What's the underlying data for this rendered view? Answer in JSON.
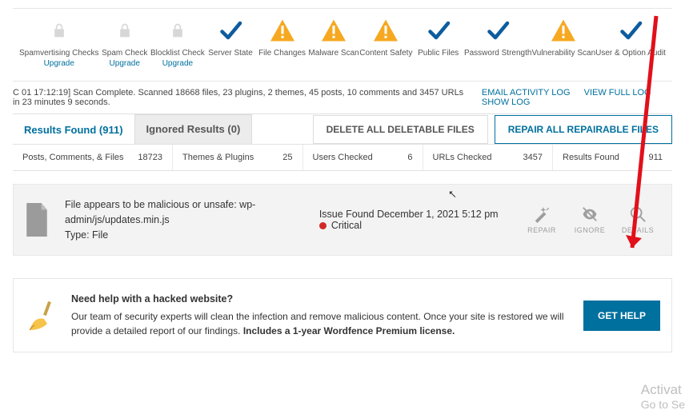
{
  "steps": [
    {
      "label": "Spamvertising Checks",
      "icon": "lock",
      "upgrade": "Upgrade"
    },
    {
      "label": "Spam Check",
      "icon": "lock",
      "upgrade": "Upgrade"
    },
    {
      "label": "Blocklist Check",
      "icon": "lock",
      "upgrade": "Upgrade"
    },
    {
      "label": "Server State",
      "icon": "check"
    },
    {
      "label": "File Changes",
      "icon": "warn"
    },
    {
      "label": "Malware Scan",
      "icon": "warn"
    },
    {
      "label": "Content Safety",
      "icon": "warn"
    },
    {
      "label": "Public Files",
      "icon": "check"
    },
    {
      "label": "Password Strength",
      "icon": "check"
    },
    {
      "label": "Vulnerability Scan",
      "icon": "warn"
    },
    {
      "label": "User & Option Audit",
      "icon": "check"
    }
  ],
  "log_line": "C 01 17:12:19] Scan Complete. Scanned 18668 files, 23 plugins, 2 themes, 45 posts, 10 comments and 3457 URLs in 23 minutes 9 seconds.",
  "log_links": {
    "email": "EMAIL ACTIVITY LOG",
    "view": "VIEW FULL LOG",
    "show": "SHOW LOG"
  },
  "tabs": {
    "found": "Results Found (911)",
    "ignored": "Ignored Results (0)"
  },
  "actions": {
    "delete": "DELETE ALL DELETABLE FILES",
    "repair": "REPAIR ALL REPAIRABLE FILES"
  },
  "stats": [
    {
      "label": "Posts, Comments, & Files",
      "value": "18723"
    },
    {
      "label": "Themes & Plugins",
      "value": "25"
    },
    {
      "label": "Users Checked",
      "value": "6"
    },
    {
      "label": "URLs Checked",
      "value": "3457"
    },
    {
      "label": "Results Found",
      "value": "911"
    }
  ],
  "issue": {
    "file_line": "File appears to be malicious or unsafe: wp-admin/js/updates.min.js",
    "type_line": "Type: File",
    "found_line": "Issue Found December 1, 2021 5:12 pm",
    "sev": "Critical",
    "btn_repair": "REPAIR",
    "btn_ignore": "IGNORE",
    "btn_details": "DETAILS"
  },
  "help": {
    "title": "Need help with a hacked website?",
    "body_a": "Our team of security experts will clean the infection and remove malicious content. Once your site is restored we will provide a detailed report of our findings. ",
    "body_b": "Includes a 1-year Wordfence Premium license.",
    "button": "GET HELP"
  },
  "watermark": {
    "line1": "Activat",
    "line2": "Go to Se"
  }
}
